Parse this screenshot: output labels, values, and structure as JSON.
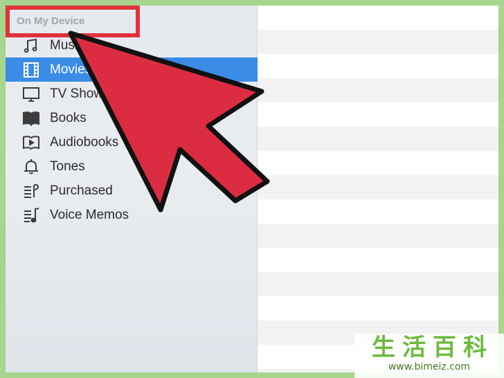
{
  "sidebar": {
    "section_header": "On My Device",
    "items": [
      {
        "label": "Music",
        "icon": "music-note-icon",
        "selected": false
      },
      {
        "label": "Movies",
        "icon": "film-icon",
        "selected": true
      },
      {
        "label": "TV Shows",
        "icon": "tv-icon",
        "selected": false
      },
      {
        "label": "Books",
        "icon": "book-icon",
        "selected": false
      },
      {
        "label": "Audiobooks",
        "icon": "audiobook-icon",
        "selected": false
      },
      {
        "label": "Tones",
        "icon": "bell-icon",
        "selected": false
      },
      {
        "label": "Purchased",
        "icon": "purchased-list-icon",
        "selected": false
      },
      {
        "label": "Voice Memos",
        "icon": "voice-memo-icon",
        "selected": false
      }
    ]
  },
  "colors": {
    "selection": "#3a8ce6",
    "highlight_box": "#e0323c",
    "arrow_fill": "#dc2c42",
    "page_border": "#a7d58d",
    "watermark_green": "#6cbb3c"
  },
  "annotation": {
    "arrow": "red-pointer-arrow",
    "highlight": "section-header-highlight-box"
  },
  "watermark": {
    "chinese": "生活百科",
    "url": "www.bimeiz.com"
  }
}
